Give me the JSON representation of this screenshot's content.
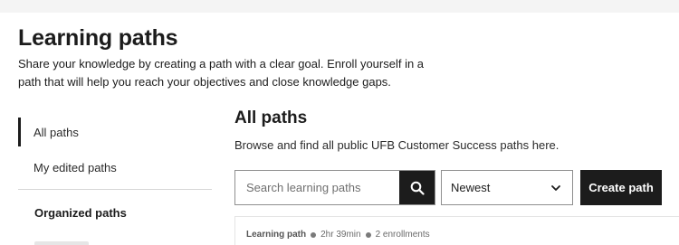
{
  "header": {
    "title": "Learning paths",
    "description": "Share your knowledge by creating a path with a clear goal. Enroll yourself in a path that will help you reach your objectives and close knowledge gaps."
  },
  "sidebar": {
    "items": [
      {
        "label": "All paths",
        "active": true
      },
      {
        "label": "My edited paths",
        "active": false
      }
    ],
    "section_heading": "Organized paths"
  },
  "main": {
    "title": "All paths",
    "description": "Browse and find all public UFB Customer Success paths here.",
    "search": {
      "placeholder": "Search learning paths",
      "value": ""
    },
    "search_button_icon": "search-icon",
    "sort": {
      "selected": "Newest"
    },
    "create_button_label": "Create path",
    "cards": [
      {
        "type": "Learning path",
        "duration": "2hr 39min",
        "enrollments": "2 enrollments"
      }
    ]
  },
  "colors": {
    "primary": "#1c1c1c",
    "border": "#8f8f8f",
    "text": "#1c1c1c",
    "muted": "#6a6a6a",
    "topbar": "#f4f4f4"
  }
}
